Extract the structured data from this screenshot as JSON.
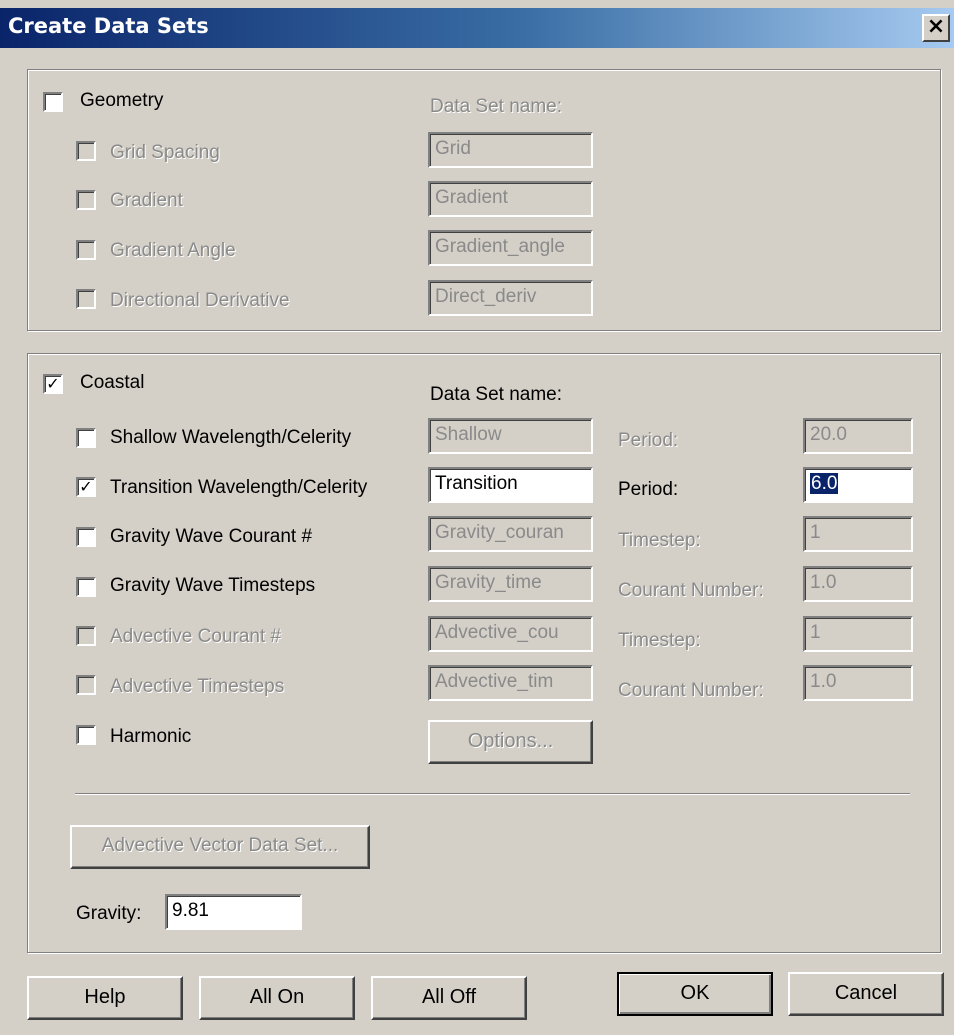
{
  "window": {
    "title": "Create Data Sets",
    "close_glyph": "×"
  },
  "geometry": {
    "label": "Geometry",
    "checked": false,
    "dataset_header": "Data Set name:",
    "items": [
      {
        "label": "Grid Spacing",
        "value": "Grid",
        "checked": false
      },
      {
        "label": "Gradient",
        "value": "Gradient",
        "checked": false
      },
      {
        "label": "Gradient Angle",
        "value": "Gradient_angle",
        "checked": false
      },
      {
        "label": "Directional Derivative",
        "value": "Direct_deriv",
        "checked": false
      }
    ]
  },
  "coastal": {
    "label": "Coastal",
    "checked": true,
    "checked_glyph": "✓",
    "dataset_header": "Data Set name:",
    "items": [
      {
        "label": "Shallow Wavelength/Celerity",
        "value": "Shallow",
        "checked": false,
        "param_label": "Period:",
        "param_value": "20.0"
      },
      {
        "label": "Transition Wavelength/Celerity",
        "value": "Transition",
        "checked": true,
        "param_label": "Period:",
        "param_value": "6.0"
      },
      {
        "label": "Gravity Wave Courant #",
        "value": "Gravity_couran",
        "checked": false,
        "param_label": "Timestep:",
        "param_value": "1"
      },
      {
        "label": "Gravity Wave Timesteps",
        "value": "Gravity_time",
        "checked": false,
        "param_label": "Courant Number:",
        "param_value": "1.0"
      },
      {
        "label": "Advective Courant #",
        "value": "Advective_cou",
        "checked": false,
        "param_label": "Timestep:",
        "param_value": "1"
      },
      {
        "label": "Advective Timesteps",
        "value": "Advective_tim",
        "checked": false,
        "param_label": "Courant Number:",
        "param_value": "1.0"
      },
      {
        "label": "Harmonic",
        "checked": false
      }
    ],
    "options_button": "Options...",
    "advective_vector_button": "Advective Vector Data Set...",
    "gravity_label": "Gravity:",
    "gravity_value": "9.81"
  },
  "buttons": {
    "help": "Help",
    "all_on": "All On",
    "all_off": "All Off",
    "ok": "OK",
    "cancel": "Cancel"
  }
}
